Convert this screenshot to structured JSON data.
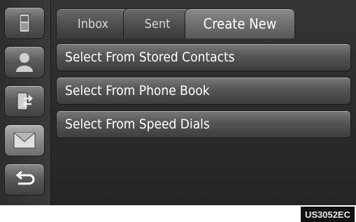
{
  "tabs": [
    {
      "label": "Inbox",
      "icon": "inbox-tab"
    },
    {
      "label": "Sent",
      "icon": "sent-tab"
    },
    {
      "label": "Create New",
      "icon": "create-new-tab"
    }
  ],
  "active_tab": "Create New",
  "options": [
    {
      "label": "Select From Stored Contacts"
    },
    {
      "label": "Select From Phone Book"
    },
    {
      "label": "Select From Speed Dials"
    }
  ],
  "sidebar": {
    "items": [
      {
        "icon": "phone-icon"
      },
      {
        "icon": "contact-icon"
      },
      {
        "icon": "transfer-icon"
      },
      {
        "icon": "message-icon"
      },
      {
        "icon": "back-icon"
      }
    ]
  },
  "footer": {
    "code": "US3052EC"
  }
}
